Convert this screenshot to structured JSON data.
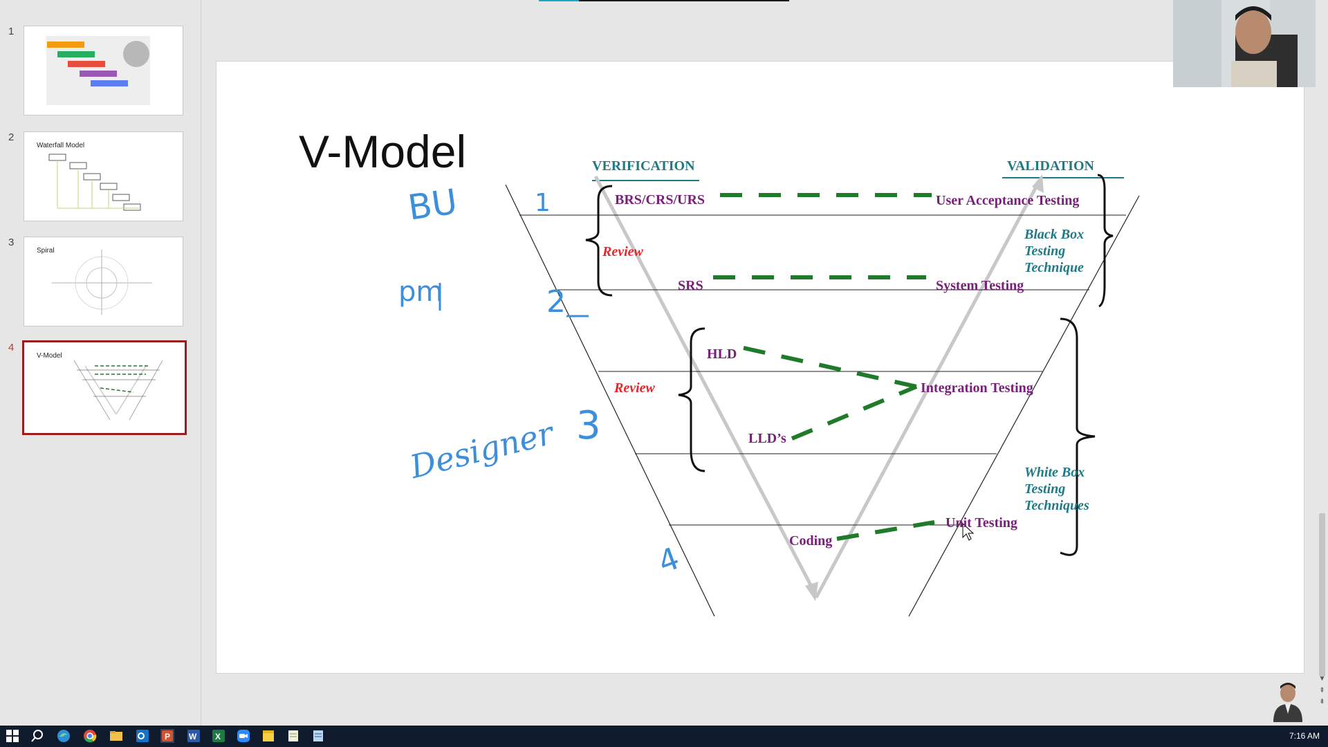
{
  "progress": {
    "fraction": 0.16
  },
  "thumbnails": [
    {
      "number": "1",
      "title": ""
    },
    {
      "number": "2",
      "title": "Waterfall Model"
    },
    {
      "number": "3",
      "title": "Spiral"
    },
    {
      "number": "4",
      "title": "V-Model"
    }
  ],
  "slide": {
    "title": "V-Model",
    "verification": "VERIFICATION",
    "validation": "VALIDATION",
    "left_phases": {
      "brs": "BRS/CRS/URS",
      "srs": "SRS",
      "hld": "HLD",
      "lld": "LLD’s",
      "coding": "Coding"
    },
    "right_phases": {
      "uat": "User Acceptance Testing",
      "system": "System Testing",
      "integration": "Integration Testing",
      "unit": "Unit Testing"
    },
    "review_1": "Review",
    "review_2": "Review",
    "black_box": "Black Box\nTesting\nTechnique",
    "white_box": "White Box\nTesting\nTechniques"
  },
  "annotations": {
    "bu": "BU",
    "pm": "pm",
    "designer": "Designer",
    "one": "1",
    "two": "2",
    "three": "3",
    "four": "4"
  },
  "taskbar": {
    "time": "7:16 AM",
    "apps": [
      "windows-start-icon",
      "search-icon",
      "edge-icon",
      "chrome-icon",
      "file-explorer-icon",
      "outlook-icon",
      "powerpoint-icon",
      "word-icon",
      "excel-icon",
      "zoom-icon",
      "sticky-notes-icon",
      "notepad-icon",
      "notepad-plus-icon"
    ]
  },
  "colors": {
    "accent_red": "#9b1c1c",
    "purple_text": "#7a1f7a",
    "teal_text": "#1f7a86",
    "review_red": "#e8252b",
    "green_dash": "#1f7a2a",
    "handwriting_blue": "#3d8fdb",
    "taskbar": "#101b2d"
  }
}
